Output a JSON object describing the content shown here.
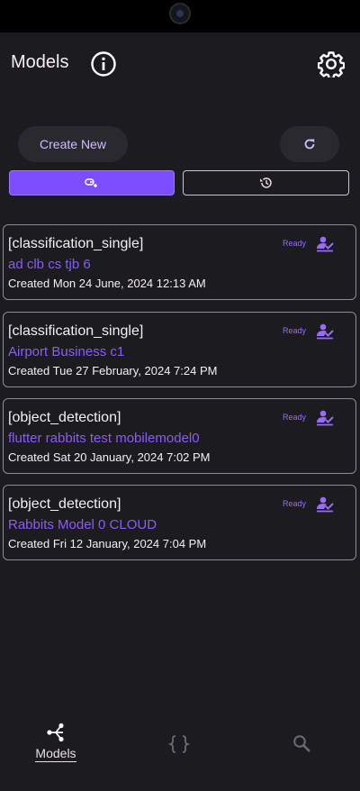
{
  "header": {
    "title": "Models",
    "info_icon": "info-icon",
    "settings_icon": "settings-gear-icon"
  },
  "actions": {
    "create_label": "Create New",
    "refresh_icon": "refresh-icon"
  },
  "segments": [
    {
      "icon": "model-link-icon",
      "selected": true
    },
    {
      "icon": "history-icon",
      "selected": false
    }
  ],
  "models": [
    {
      "type": "[classification_single]",
      "name": "ad clb cs tjb 6",
      "created": "Created Mon 24 June, 2024 12:13 AM",
      "status": "Ready"
    },
    {
      "type": "[classification_single]",
      "name": "Airport Business c1",
      "created": "Created Tue 27 February, 2024 7:24 PM",
      "status": "Ready"
    },
    {
      "type": "[object_detection]",
      "name": "flutter rabbits test mobilemodel0",
      "created": "Created Sat 20 January, 2024 7:02 PM",
      "status": "Ready"
    },
    {
      "type": "[object_detection]",
      "name": "Rabbits Model 0 CLOUD",
      "created": "Created Fri 12 January, 2024 7:04 PM",
      "status": "Ready"
    }
  ],
  "nav": {
    "models_label": "Models",
    "items": [
      "models-icon",
      "code-braces-icon",
      "search-icon"
    ]
  },
  "colors": {
    "background": "#1c1b1f",
    "accent": "#7c4dff",
    "model_name": "#8a5cf6",
    "status": "#9a6bff"
  }
}
